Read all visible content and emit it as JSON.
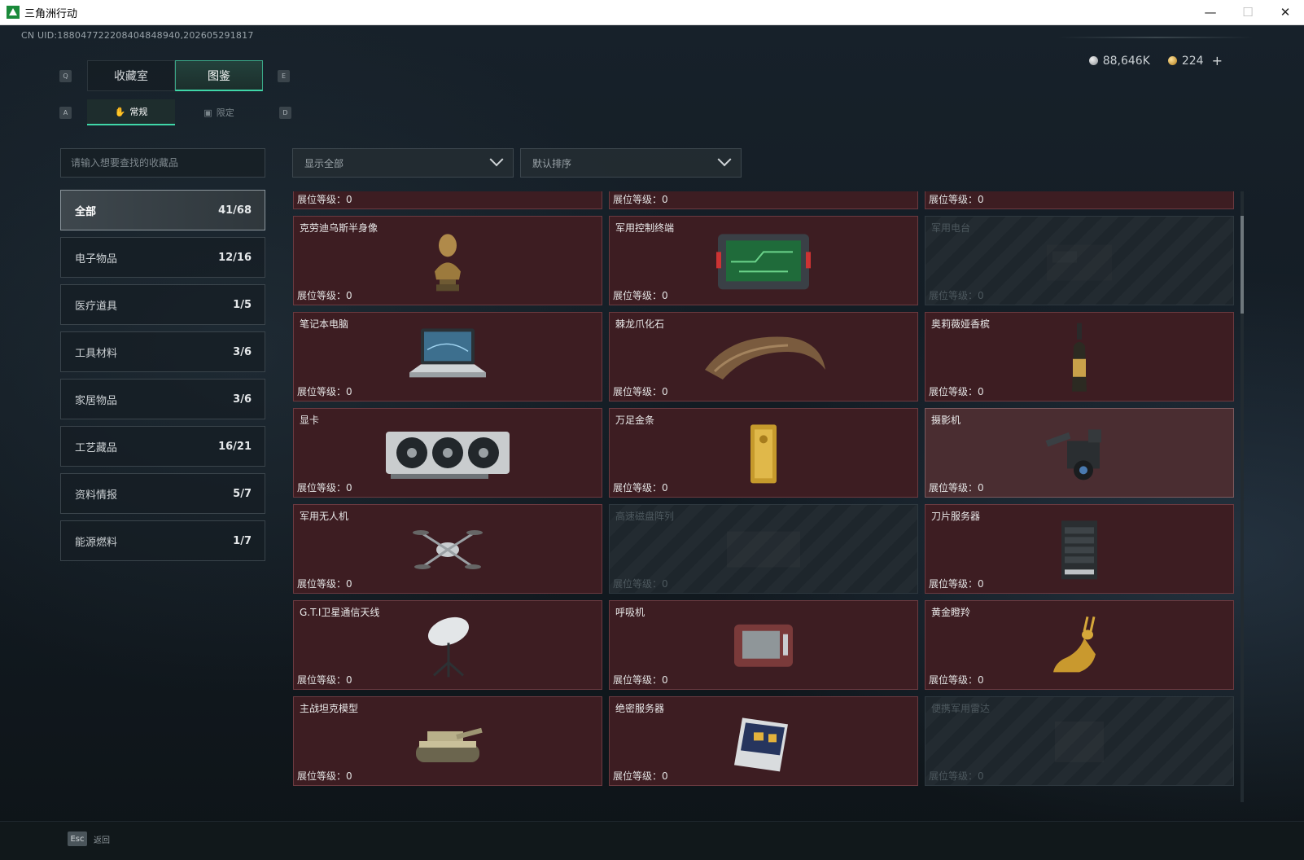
{
  "window": {
    "title": "三角洲行动",
    "minimize": "—",
    "maximize": "☐",
    "close": "✕"
  },
  "uid": "CN UID:18804772220840484894​0,202605291817",
  "currency": {
    "silver": "88,646K",
    "gold": "224",
    "add": "+"
  },
  "keys": {
    "prev_tab": "Q",
    "next_tab": "E",
    "prev_sub": "A",
    "next_sub": "D"
  },
  "main_tabs": [
    {
      "label": "收藏室"
    },
    {
      "label": "图鉴"
    }
  ],
  "sub_tabs": [
    {
      "label": "常规",
      "icon": "✋"
    },
    {
      "label": "限定",
      "icon": "▣"
    }
  ],
  "search": {
    "placeholder": "请输入想要查找的收藏品"
  },
  "filter": {
    "value": "显示全部"
  },
  "sort": {
    "value": "默认排序"
  },
  "categories": [
    {
      "label": "全部",
      "count": "41/68"
    },
    {
      "label": "电子物品",
      "count": "12/16"
    },
    {
      "label": "医疗道具",
      "count": "1/5"
    },
    {
      "label": "工具材料",
      "count": "3/6"
    },
    {
      "label": "家居物品",
      "count": "3/6"
    },
    {
      "label": "工艺藏品",
      "count": "16/21"
    },
    {
      "label": "资料情报",
      "count": "5/7"
    },
    {
      "label": "能源燃料",
      "count": "1/7"
    }
  ],
  "level_label": "展位等级：",
  "items": [
    {
      "name": "",
      "level": "0",
      "state": "owned"
    },
    {
      "name": "",
      "level": "0",
      "state": "owned"
    },
    {
      "name": "",
      "level": "0",
      "state": "owned"
    },
    {
      "name": "克劳迪乌斯半身像",
      "level": "0",
      "state": "owned",
      "icon": "bust-icon"
    },
    {
      "name": "军用控制终端",
      "level": "0",
      "state": "owned",
      "icon": "terminal-icon"
    },
    {
      "name": "军用电台",
      "level": "0",
      "state": "locked",
      "icon": "radio-icon"
    },
    {
      "name": "笔记本电脑",
      "level": "0",
      "state": "owned",
      "icon": "laptop-icon"
    },
    {
      "name": "棘龙爪化石",
      "level": "0",
      "state": "owned",
      "icon": "claw-fossil-icon"
    },
    {
      "name": "奥莉薇娅香槟",
      "level": "0",
      "state": "owned",
      "icon": "champagne-icon"
    },
    {
      "name": "显卡",
      "level": "0",
      "state": "owned",
      "icon": "gpu-icon"
    },
    {
      "name": "万足金条",
      "level": "0",
      "state": "owned",
      "icon": "gold-bar-icon"
    },
    {
      "name": "摄影机",
      "level": "0",
      "state": "highlight",
      "icon": "camera-icon"
    },
    {
      "name": "军用无人机",
      "level": "0",
      "state": "owned",
      "icon": "drone-icon"
    },
    {
      "name": "高速磁盘阵列",
      "level": "0",
      "state": "locked",
      "icon": "disk-array-icon"
    },
    {
      "name": "刀片服务器",
      "level": "0",
      "state": "owned",
      "icon": "blade-server-icon"
    },
    {
      "name": "G.T.I卫星通信天线",
      "level": "0",
      "state": "owned",
      "icon": "satellite-dish-icon"
    },
    {
      "name": "呼吸机",
      "level": "0",
      "state": "owned",
      "icon": "ventilator-icon"
    },
    {
      "name": "黄金瞪羚",
      "level": "0",
      "state": "owned",
      "icon": "gold-gazelle-icon"
    },
    {
      "name": "主战坦克模型",
      "level": "0",
      "state": "owned",
      "icon": "tank-icon"
    },
    {
      "name": "绝密服务器",
      "level": "0",
      "state": "owned",
      "icon": "server-board-icon"
    },
    {
      "name": "便携军用雷达",
      "level": "0",
      "state": "locked",
      "icon": "radar-icon"
    }
  ],
  "footer": {
    "esc_key": "Esc",
    "back_label": "返回"
  },
  "colors": {
    "accent": "#3fd6a8",
    "card_owned": "#3d1d22",
    "card_locked": "#1e262c"
  }
}
